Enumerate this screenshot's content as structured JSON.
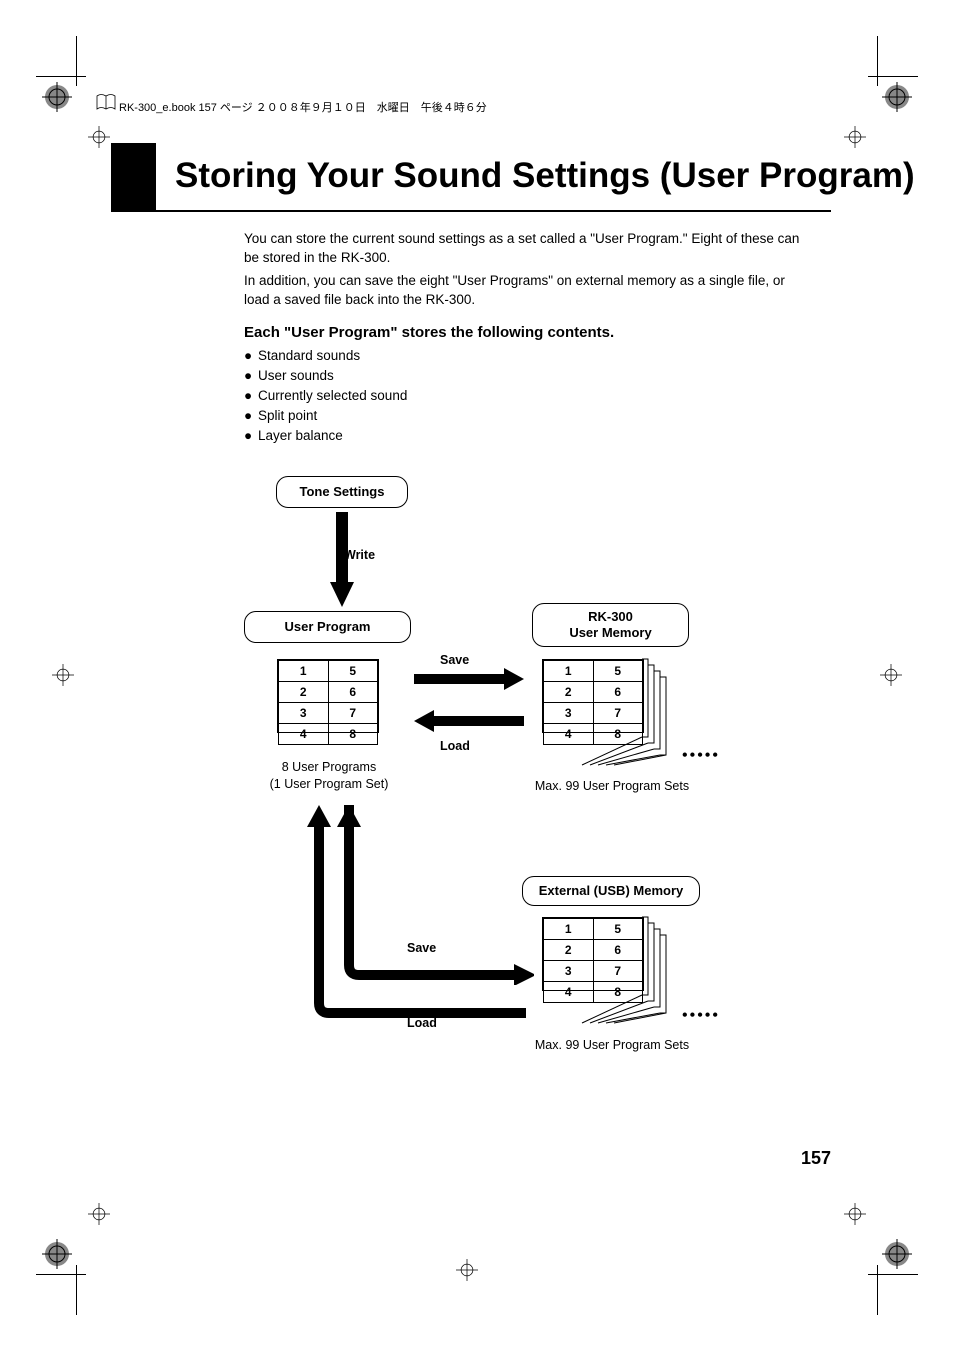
{
  "header": {
    "runner": "RK-300_e.book  157 ページ  ２００８年９月１０日　水曜日　午後４時６分"
  },
  "title": "Storing Your Sound Settings (User Program)",
  "intro": {
    "p1": "You can store the current sound settings as a set called a \"User Program.\" Eight of these can be stored in the RK-300.",
    "p2": "In addition, you can save the eight \"User Programs\" on external memory as a single file, or load a saved file back into the RK-300."
  },
  "subhead": "Each \"User Program\" stores the following contents.",
  "bullets": [
    "Standard sounds",
    "User sounds",
    "Currently selected sound",
    "Split point",
    "Layer balance"
  ],
  "diagram": {
    "tone_settings": "Tone Settings",
    "write": "Write",
    "user_program": "User Program",
    "rk300_line1": "RK-300",
    "rk300_line2": "User Memory",
    "external": "External (USB) Memory",
    "save": "Save",
    "load": "Load",
    "grid": [
      "1",
      "5",
      "2",
      "6",
      "3",
      "7",
      "4",
      "8"
    ],
    "cap_userprog_l1": "8 User Programs",
    "cap_userprog_l2": "(1 User Program Set)",
    "cap_max": "Max. 99 User Program Sets"
  },
  "page_number": "157"
}
